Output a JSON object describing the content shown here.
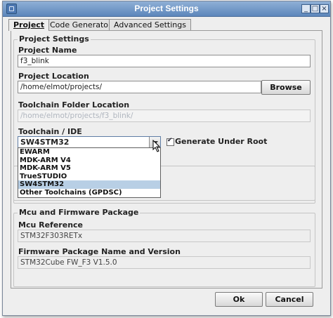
{
  "window": {
    "title": "Project Settings",
    "icon": "app-icon",
    "controls": [
      "minimize-icon",
      "maximize-icon",
      "close-icon"
    ]
  },
  "tabs": [
    {
      "label": "Project",
      "active": true
    },
    {
      "label": "Code Generator",
      "active": false
    },
    {
      "label": "Advanced Settings",
      "active": false
    }
  ],
  "project_settings": {
    "group_title": "Project Settings",
    "project_name_label": "Project Name",
    "project_name_value": "f3_blink",
    "project_location_label": "Project Location",
    "project_location_value": "/home/elmot/projects/",
    "browse_label": "Browse",
    "toolchain_folder_label": "Toolchain Folder Location",
    "toolchain_folder_value": "/home/elmot/projects/f3_blink/",
    "toolchain_ide_label": "Toolchain / IDE",
    "toolchain_selected": "SW4STM32",
    "toolchain_options": [
      "EWARM",
      "MDK-ARM V4",
      "MDK-ARM V5",
      "TrueSTUDIO",
      "SW4STM32",
      "Other Toolchains (GPDSC)"
    ],
    "generate_under_root_label": "Generate Under Root",
    "generate_under_root_checked": true
  },
  "mcu": {
    "group_title": "Mcu and Firmware Package",
    "mcu_reference_label": "Mcu Reference",
    "mcu_reference_value": "STM32F303RETx",
    "firmware_label": "Firmware Package Name and Version",
    "firmware_value": "STM32Cube FW_F3 V1.5.0"
  },
  "footer": {
    "ok_label": "Ok",
    "cancel_label": "Cancel"
  },
  "colors": {
    "titlebar": "#5c86bb",
    "selection": "#b8cfe5"
  }
}
